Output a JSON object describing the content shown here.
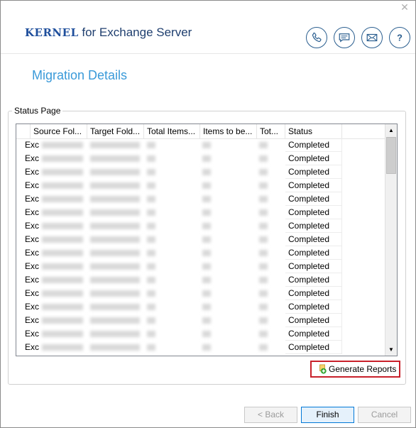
{
  "header": {
    "brand_kernel": "Kernel",
    "brand_rest": " for Exchange Server",
    "close_glyph": "✕",
    "icons": [
      "phone-icon",
      "chat-icon",
      "mail-icon",
      "help-icon"
    ],
    "accent_color": "#2a5e8f"
  },
  "page": {
    "subtitle": "Migration Details",
    "group_title": "Status Page"
  },
  "grid": {
    "columns": [
      "Source Fol...",
      "Target Fold...",
      "Total Items...",
      "Items to be...",
      "Tot...",
      "Status"
    ],
    "rows": [
      {
        "source": "Exc",
        "status": "Completed"
      },
      {
        "source": "Exc",
        "status": "Completed"
      },
      {
        "source": "Exc",
        "status": "Completed"
      },
      {
        "source": "Exc",
        "status": "Completed"
      },
      {
        "source": "Exc",
        "status": "Completed"
      },
      {
        "source": "Exc",
        "status": "Completed"
      },
      {
        "source": "Exc",
        "status": "Completed"
      },
      {
        "source": "Exc",
        "status": "Completed"
      },
      {
        "source": "Exc",
        "status": "Completed"
      },
      {
        "source": "Exc",
        "status": "Completed"
      },
      {
        "source": "Exc",
        "status": "Completed"
      },
      {
        "source": "Exc",
        "status": "Completed"
      },
      {
        "source": "Exc",
        "status": "Completed"
      },
      {
        "source": "Exc",
        "status": "Completed"
      },
      {
        "source": "Exc",
        "status": "Completed"
      },
      {
        "source": "Exc",
        "status": "Completed"
      }
    ]
  },
  "actions": {
    "generate_reports": "Generate Reports",
    "generate_color": "#c8202a"
  },
  "footer": {
    "back": "< Back",
    "finish": "Finish",
    "cancel": "Cancel"
  }
}
